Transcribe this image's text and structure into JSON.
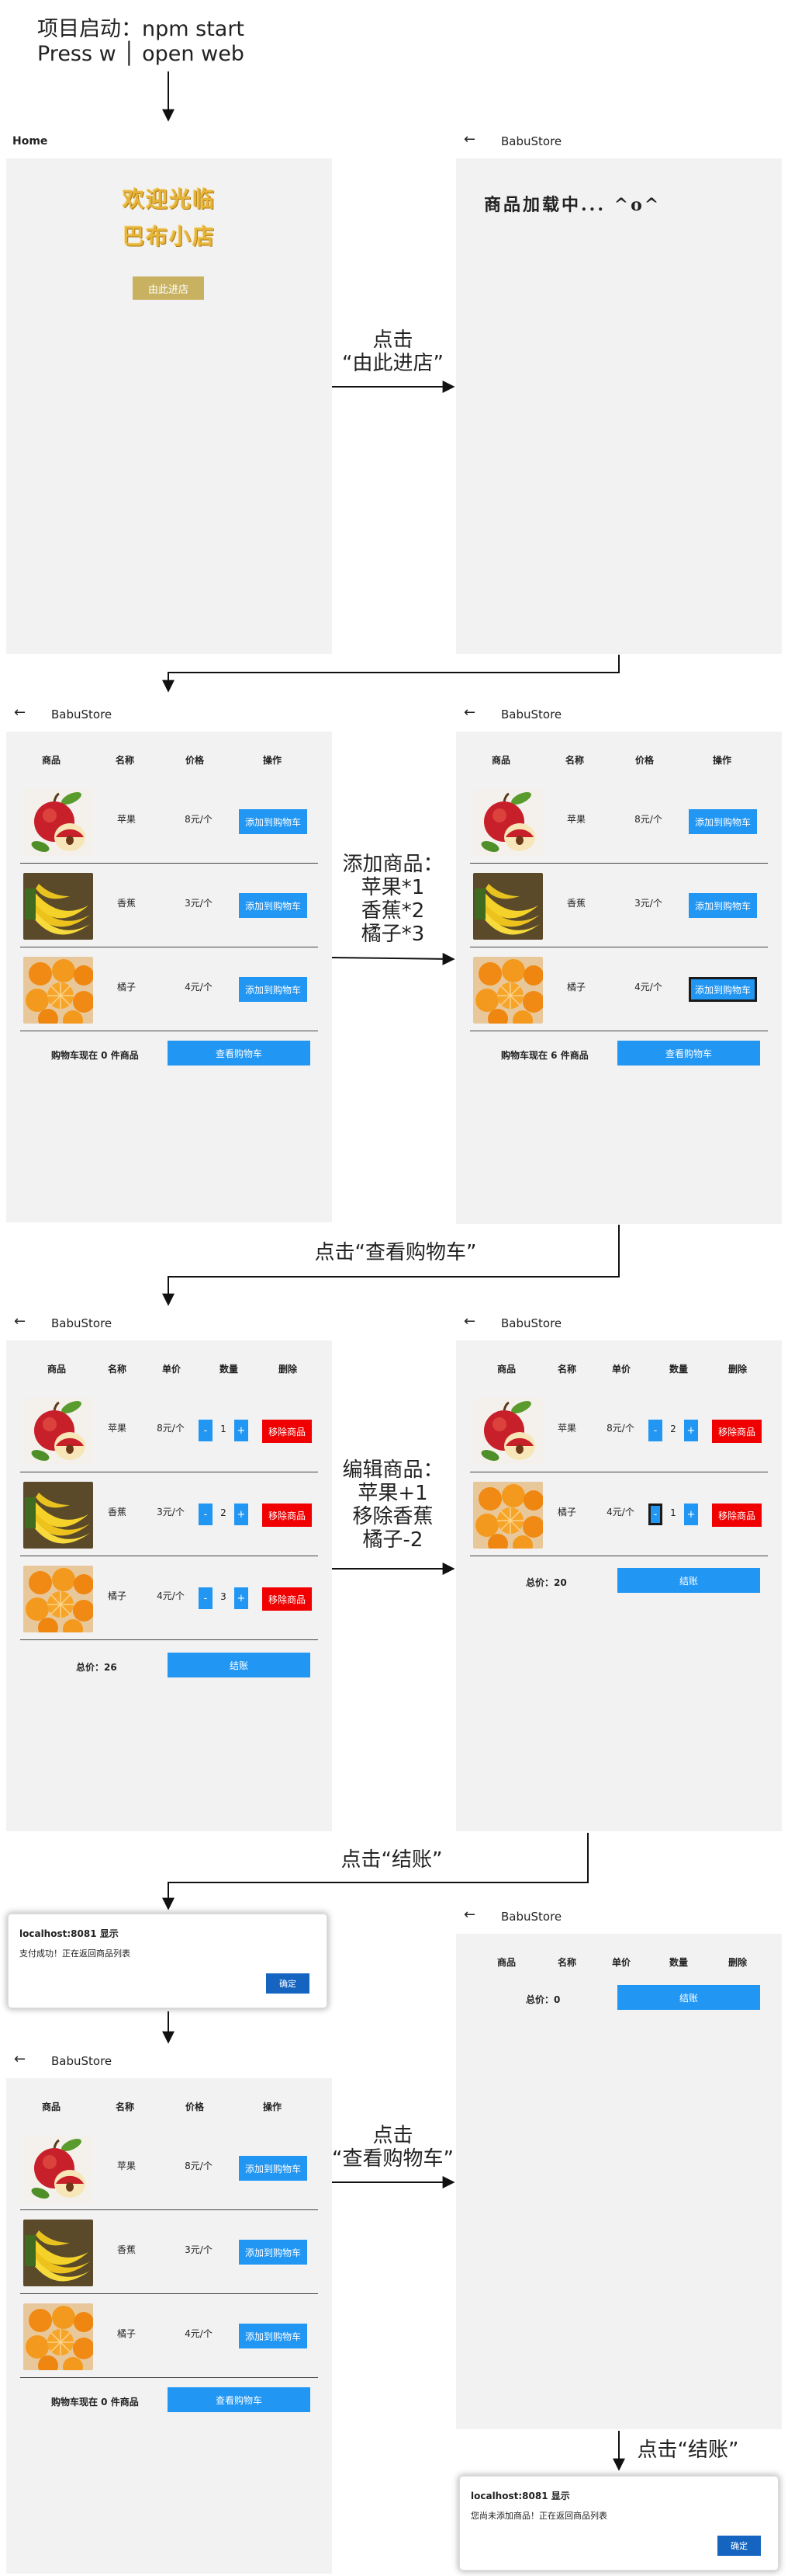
{
  "header": {
    "line1": "项目启动：npm start",
    "line2": "Press w │ open web"
  },
  "captions": {
    "c1": [
      "点击",
      "“由此进店”"
    ],
    "c2": [
      "添加商品：",
      "苹果*1",
      "香蕉*2",
      "橘子*3"
    ],
    "c3": [
      "点击“查看购物车”"
    ],
    "c4": [
      "编辑商品：",
      "苹果+1",
      "移除香蕉",
      "橘子-2"
    ],
    "c5": [
      "点击“结账”"
    ],
    "c6": [
      "点击",
      "“查看购物车”"
    ],
    "c7": [
      "点击“结账”"
    ]
  },
  "common": {
    "back": "←",
    "store_title": "BabuStore",
    "home_title": "Home",
    "welcome_line1": "欢迎光临",
    "welcome_line2": "巴布小店",
    "enter_btn": "由此进店",
    "loading": "商品加载中... ^o^",
    "list_headers": [
      "商品",
      "名称",
      "价格",
      "操作"
    ],
    "cart_headers": [
      "商品",
      "名称",
      "单价",
      "数量",
      "删除"
    ],
    "add_btn": "添加到购物车",
    "view_cart_btn": "查看购物车",
    "remove_btn": "移除商品",
    "checkout_btn": "结账",
    "minus": "-",
    "plus": "+"
  },
  "fruits": {
    "apple": {
      "name": "苹果",
      "price": "8元/个"
    },
    "banana": {
      "name": "香蕉",
      "price": "3元/个"
    },
    "orange": {
      "name": "橘子",
      "price": "4元/个"
    }
  },
  "list_before": {
    "cart_summary": "购物车现在 0 件商品"
  },
  "list_after": {
    "cart_summary": "购物车现在 6 件商品"
  },
  "list_final": {
    "cart_summary": "购物车现在 0 件商品"
  },
  "cart1": {
    "qty_apple": "1",
    "qty_banana": "2",
    "qty_orange": "3",
    "total": "总价：26"
  },
  "cart2": {
    "qty_apple": "2",
    "qty_orange": "1",
    "total": "总价：20"
  },
  "cart3": {
    "total": "总价：0"
  },
  "dialog1": {
    "title": "localhost:8081 显示",
    "message": "支付成功！正在返回商品列表",
    "ok": "确定"
  },
  "dialog2": {
    "title": "localhost:8081 显示",
    "message": "您尚未添加商品！正在返回商品列表",
    "ok": "确定"
  },
  "colors": {
    "accent_blue": "#2196f3",
    "remove_red": "#f00000",
    "welcome_gold": "#e6b43a",
    "enter_btn": "#c8b261",
    "screen_bg": "#f2f2f2"
  }
}
